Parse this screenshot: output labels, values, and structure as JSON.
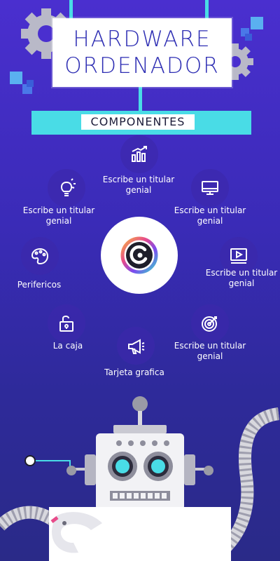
{
  "header": {
    "title_line1": "HARDWARE",
    "title_line2": "ORDENADOR",
    "banner": "COMPONENTES"
  },
  "nodes": [
    {
      "icon": "bar-chart-icon",
      "label": "Escribe un titular genial"
    },
    {
      "icon": "lightbulb-icon",
      "label": "Escribe un titular genial"
    },
    {
      "icon": "monitor-icon",
      "label": "Escribe un titular genial"
    },
    {
      "icon": "palette-icon",
      "label": "Perifericos"
    },
    {
      "icon": "video-icon",
      "label": "Escribe un titular genial"
    },
    {
      "icon": "unlock-icon",
      "label": "La caja"
    },
    {
      "icon": "target-icon",
      "label": "Escribe un titular genial"
    },
    {
      "icon": "megaphone-icon",
      "label": "Tarjeta grafica"
    }
  ],
  "center": {
    "icon": "brand-logo-icon"
  },
  "colors": {
    "background": "#3a2bb7",
    "accent": "#49dce6",
    "title": "#2d2db3",
    "robot_eye": "#49dce6"
  }
}
